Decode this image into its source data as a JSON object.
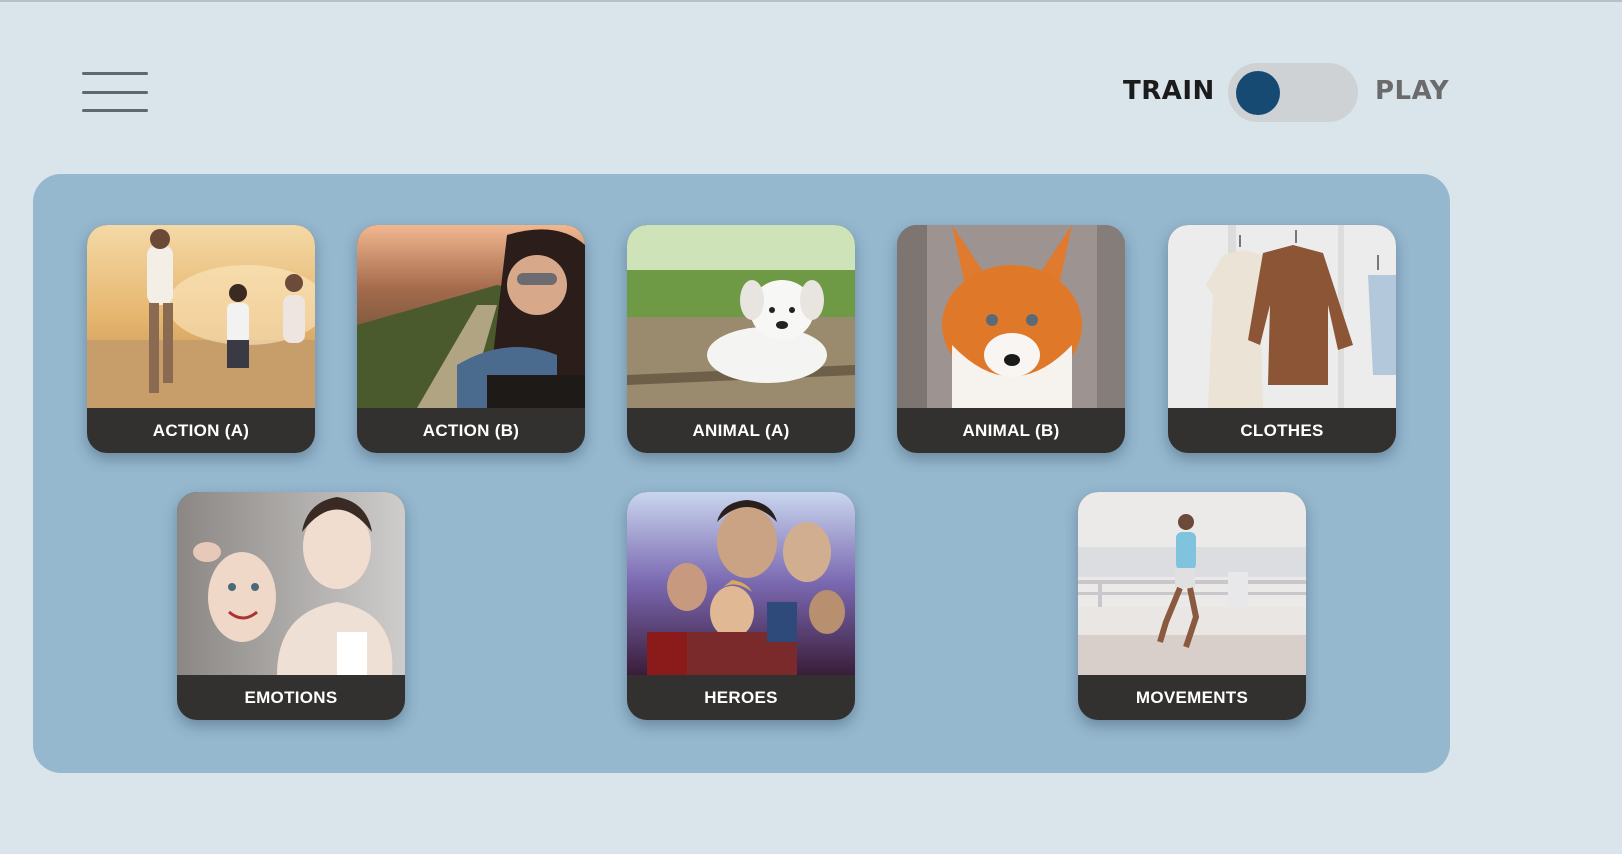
{
  "header": {
    "menu_icon": "hamburger-menu-icon",
    "train_label": "TRAIN",
    "play_label": "PLAY",
    "mode_state": "train"
  },
  "colors": {
    "background": "#d9e4eb",
    "panel": "#95b8cf",
    "card_label_bg": "#333030",
    "toggle_knob": "#174a73",
    "toggle_track": "#cfd2d4"
  },
  "categories": [
    {
      "label": "ACTION (A)",
      "image": "family running on beach"
    },
    {
      "label": "ACTION (B)",
      "image": "woman with sunglasses leaning out of car window"
    },
    {
      "label": "ANIMAL (A)",
      "image": "white puppy lying on wooden deck"
    },
    {
      "label": "ANIMAL (B)",
      "image": "red fox face"
    },
    {
      "label": "CLOTHES",
      "image": "clothes on hangers"
    },
    {
      "label": "EMOTIONS",
      "image": "woman holding smiling mask"
    },
    {
      "label": "HEROES",
      "image": "superhero movie poster"
    },
    {
      "label": "MOVEMENTS",
      "image": "man running on promenade"
    }
  ]
}
